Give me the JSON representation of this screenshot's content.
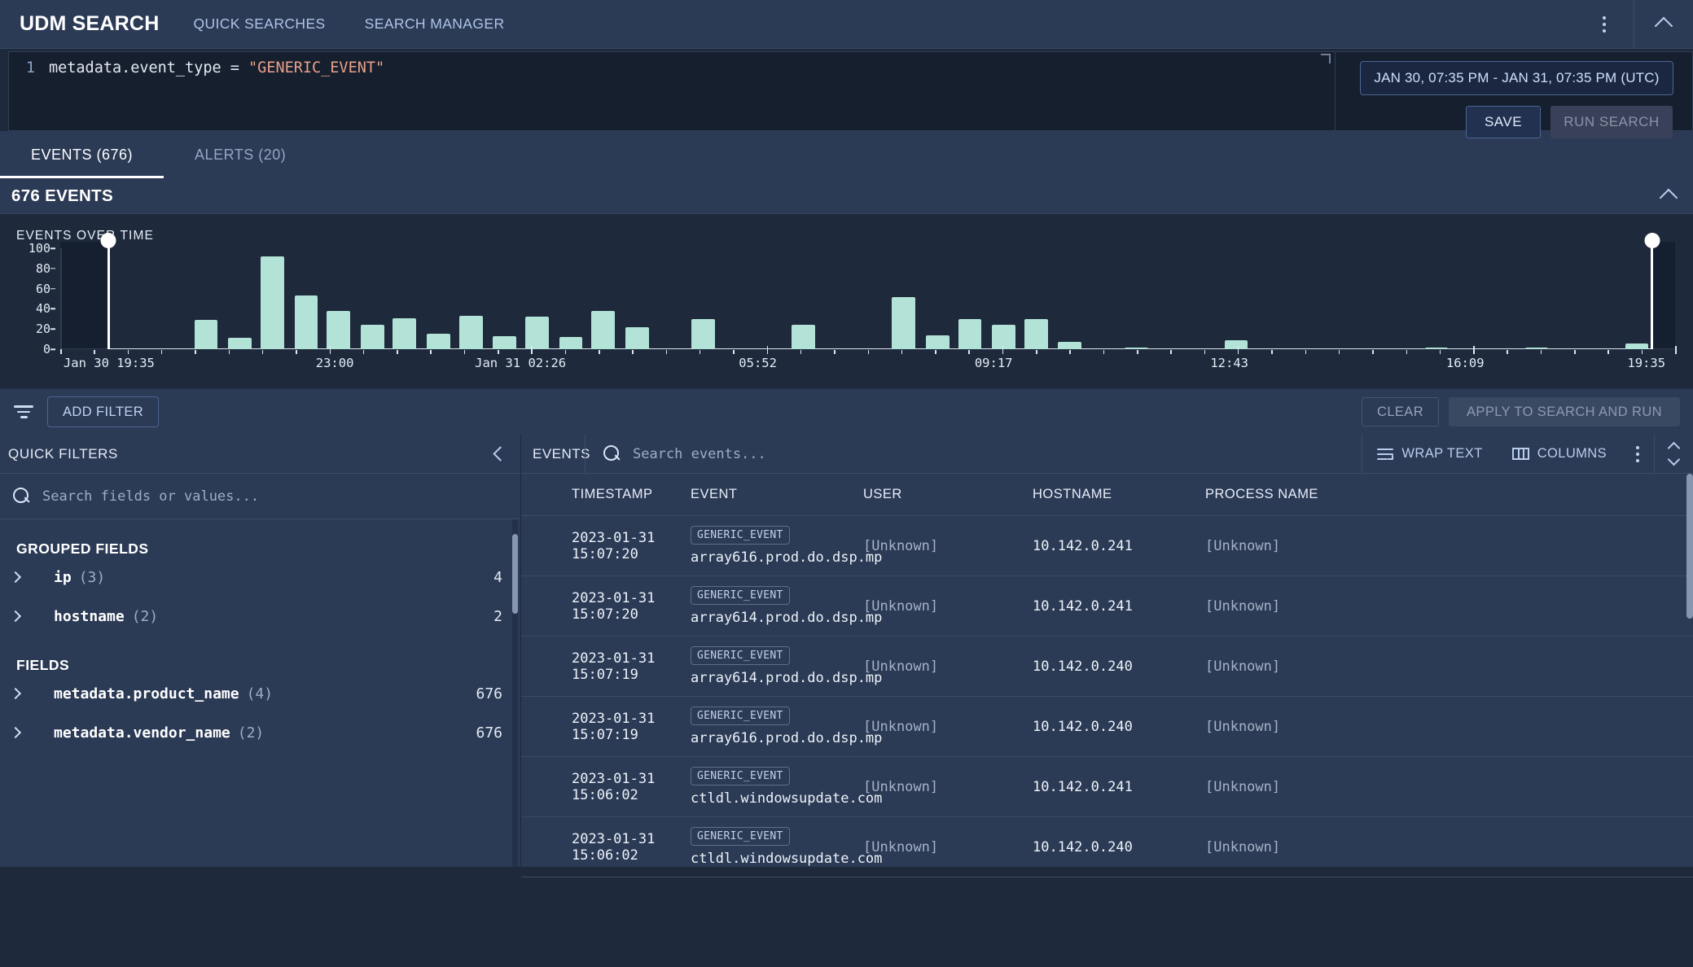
{
  "header": {
    "app_title": "UDM SEARCH",
    "nav": [
      {
        "label": "QUICK SEARCHES"
      },
      {
        "label": "SEARCH MANAGER"
      }
    ],
    "kebab_icon": "more-vertical-icon",
    "collapse_icon": "chevron-up-icon"
  },
  "query": {
    "line_number": "1",
    "text_before": "metadata.event_type = ",
    "text_string": "\"GENERIC_EVENT\"",
    "date_range": "JAN 30, 07:35 PM - JAN 31, 07:35 PM (UTC)",
    "save_label": "SAVE",
    "run_label": "RUN SEARCH"
  },
  "tabs": [
    {
      "label": "EVENTS (676)",
      "active": true
    },
    {
      "label": "ALERTS (20)",
      "active": false
    }
  ],
  "events_panel": {
    "title": "676 EVENTS",
    "collapse_icon": "chevron-up-icon"
  },
  "chart_data": {
    "type": "bar",
    "title": "EVENTS OVER TIME",
    "xlabel": "",
    "ylabel": "",
    "ylim": [
      0,
      100
    ],
    "yticks": [
      0,
      20,
      40,
      60,
      80,
      100
    ],
    "grid": false,
    "legend": null,
    "xtick_labels": [
      "Jan 30 19:35",
      "23:00",
      "Jan 31 02:26",
      "05:52",
      "09:17",
      "12:43",
      "16:09",
      "19:35"
    ],
    "xtick_positions_pct": [
      0.5,
      17.0,
      28.5,
      43.2,
      57.8,
      72.4,
      87.0,
      99.4
    ],
    "selection": {
      "start_pct": 2.9,
      "end_pct": 98.5,
      "handle_color": "#ffffff"
    },
    "bar_color": "#b2e3d6",
    "bars": [
      {
        "x_pct": 8.3,
        "value": 29
      },
      {
        "x_pct": 10.4,
        "value": 11
      },
      {
        "x_pct": 12.4,
        "value": 92
      },
      {
        "x_pct": 14.5,
        "value": 53
      },
      {
        "x_pct": 16.5,
        "value": 38
      },
      {
        "x_pct": 18.6,
        "value": 24
      },
      {
        "x_pct": 20.6,
        "value": 31
      },
      {
        "x_pct": 22.7,
        "value": 15
      },
      {
        "x_pct": 24.7,
        "value": 33
      },
      {
        "x_pct": 26.8,
        "value": 13
      },
      {
        "x_pct": 28.8,
        "value": 32
      },
      {
        "x_pct": 30.9,
        "value": 12
      },
      {
        "x_pct": 32.9,
        "value": 38
      },
      {
        "x_pct": 35.0,
        "value": 22
      },
      {
        "x_pct": 39.1,
        "value": 30
      },
      {
        "x_pct": 45.3,
        "value": 24
      },
      {
        "x_pct": 51.5,
        "value": 52
      },
      {
        "x_pct": 53.6,
        "value": 14
      },
      {
        "x_pct": 55.6,
        "value": 30
      },
      {
        "x_pct": 57.7,
        "value": 24
      },
      {
        "x_pct": 59.7,
        "value": 30
      },
      {
        "x_pct": 61.8,
        "value": 7
      },
      {
        "x_pct": 65.9,
        "value": 1
      },
      {
        "x_pct": 72.1,
        "value": 9
      },
      {
        "x_pct": 84.5,
        "value": 2
      },
      {
        "x_pct": 90.7,
        "value": 1
      },
      {
        "x_pct": 96.9,
        "value": 6
      }
    ]
  },
  "filter_bar": {
    "filter_icon": "filter-icon",
    "add_filter_label": "ADD FILTER",
    "clear_label": "CLEAR",
    "apply_label": "APPLY TO SEARCH AND RUN"
  },
  "quick_filters": {
    "title": "QUICK FILTERS",
    "collapse_icon": "chevron-left-icon",
    "search_placeholder": "Search fields or values...",
    "search_value": "",
    "search_icon": "search-icon",
    "sections": [
      {
        "title": "GROUPED FIELDS",
        "fields": [
          {
            "name": "ip",
            "count": "(3)",
            "total": "4"
          },
          {
            "name": "hostname",
            "count": "(2)",
            "total": "2"
          }
        ]
      },
      {
        "title": "FIELDS",
        "fields": [
          {
            "name": "metadata.product_name",
            "count": "(4)",
            "total": "676"
          },
          {
            "name": "metadata.vendor_name",
            "count": "(2)",
            "total": "676"
          }
        ]
      }
    ]
  },
  "events_table": {
    "label": "EVENTS",
    "search_placeholder": "Search events...",
    "search_value": "",
    "search_icon": "search-icon",
    "wrap_text_label": "WRAP TEXT",
    "wrap_text_icon": "wrap-text-icon",
    "columns_label": "COLUMNS",
    "columns_icon": "columns-icon",
    "kebab_icon": "more-vertical-icon",
    "expand_icon": "expand-rows-icon",
    "headers": [
      "TIMESTAMP",
      "EVENT",
      "USER",
      "HOSTNAME",
      "PROCESS NAME"
    ],
    "rows": [
      {
        "timestamp": "2023-01-31 15:07:20",
        "badge": "GENERIC_EVENT",
        "event": "array616.prod.do.dsp.mp",
        "user": "[Unknown]",
        "hostname": "10.142.0.241",
        "process": "[Unknown]"
      },
      {
        "timestamp": "2023-01-31 15:07:20",
        "badge": "GENERIC_EVENT",
        "event": "array614.prod.do.dsp.mp",
        "user": "[Unknown]",
        "hostname": "10.142.0.241",
        "process": "[Unknown]"
      },
      {
        "timestamp": "2023-01-31 15:07:19",
        "badge": "GENERIC_EVENT",
        "event": "array614.prod.do.dsp.mp",
        "user": "[Unknown]",
        "hostname": "10.142.0.240",
        "process": "[Unknown]"
      },
      {
        "timestamp": "2023-01-31 15:07:19",
        "badge": "GENERIC_EVENT",
        "event": "array616.prod.do.dsp.mp",
        "user": "[Unknown]",
        "hostname": "10.142.0.240",
        "process": "[Unknown]"
      },
      {
        "timestamp": "2023-01-31 15:06:02",
        "badge": "GENERIC_EVENT",
        "event": "ctldl.windowsupdate.com",
        "user": "[Unknown]",
        "hostname": "10.142.0.241",
        "process": "[Unknown]"
      },
      {
        "timestamp": "2023-01-31 15:06:02",
        "badge": "GENERIC_EVENT",
        "event": "ctldl.windowsupdate.com",
        "user": "[Unknown]",
        "hostname": "10.142.0.240",
        "process": "[Unknown]"
      }
    ]
  },
  "colors": {
    "accent_bar": "#b2e3d6",
    "panel": "#2b3a55",
    "background": "#1e293b",
    "code_bg": "#161f2e",
    "string_literal": "#e8a08a"
  }
}
